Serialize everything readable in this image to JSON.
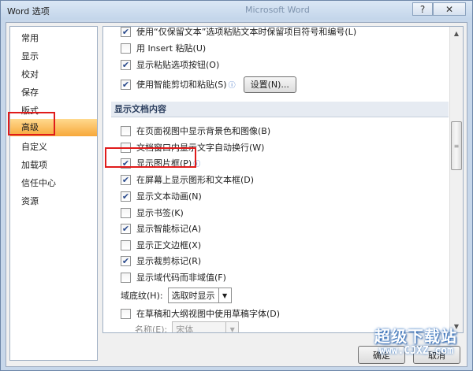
{
  "window": {
    "title": "Word 选项",
    "background_title": "Microsoft Word",
    "help_label": "?",
    "close_label": "✕"
  },
  "sidebar": {
    "items": [
      {
        "label": "常用"
      },
      {
        "label": "显示"
      },
      {
        "label": "校对"
      },
      {
        "label": "保存"
      },
      {
        "label": "版式"
      },
      {
        "label": "高级",
        "selected": true
      },
      {
        "label": "自定义"
      },
      {
        "label": "加载项"
      },
      {
        "label": "信任中心"
      },
      {
        "label": "资源"
      }
    ]
  },
  "main": {
    "options_top": [
      {
        "label": "使用“仅保留文本”选项粘贴文本时保留项目符号和编号(L)",
        "checked": true
      },
      {
        "label": "用 Insert 粘贴(U)",
        "checked": false
      },
      {
        "label": "显示粘贴选项按钮(O)",
        "checked": true
      },
      {
        "label": "使用智能剪切和粘贴(S)",
        "checked": true
      }
    ],
    "settings_button": "设置(N)...",
    "section_title": "显示文档内容",
    "display_options": [
      {
        "label": "在页面视图中显示背景色和图像(B)",
        "checked": false
      },
      {
        "label": "文档窗口内显示文字自动换行(W)",
        "checked": false
      },
      {
        "label": "显示图片框(P)",
        "checked": true
      },
      {
        "label": "在屏幕上显示图形和文本框(D)",
        "checked": true
      },
      {
        "label": "显示文本动画(N)",
        "checked": true
      },
      {
        "label": "显示书签(K)",
        "checked": false
      },
      {
        "label": "显示智能标记(A)",
        "checked": true
      },
      {
        "label": "显示正文边框(X)",
        "checked": false
      },
      {
        "label": "显示裁剪标记(R)",
        "checked": true
      },
      {
        "label": "显示域代码而非域值(F)",
        "checked": false
      }
    ],
    "field_shading": {
      "label": "域底纹(H):",
      "value": "选取时显示"
    },
    "draft_font": {
      "label": "在草稿和大纲视图中使用草稿字体(D)",
      "checked": false
    },
    "font_name": {
      "label": "名称(E):",
      "value": "宋体"
    },
    "font_size": {
      "label": "字号",
      "value": "五号"
    }
  },
  "footer": {
    "ok_label": "确定",
    "cancel_label": "取消"
  },
  "watermark": {
    "text": "超级下载站",
    "url": "www.CJXZ.com"
  },
  "colors": {
    "highlight": "#e01b1b",
    "selected_item": "#f7a83a",
    "window_frame": "#c7d7ea"
  }
}
